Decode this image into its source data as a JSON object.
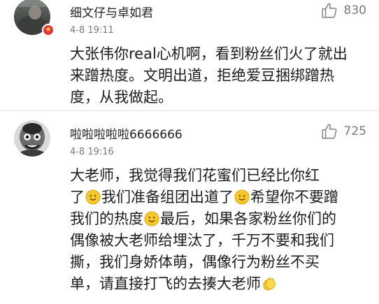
{
  "comments": [
    {
      "username": "细文仔与卓如君",
      "time": "4-8 19:11",
      "likes": "830",
      "body_lines": [
        "大张伟你real心机啊，看到粉丝们火了就出",
        "来蹭热度。文明出道，拒绝爱豆捆绑蹭热",
        "度，从我做起。"
      ]
    },
    {
      "username": "啦啦啦啦啦6666666",
      "time": "4-8 19:16",
      "likes": "725",
      "body": {
        "l1": "大老师，我觉得我们花蜜们已经比你红",
        "l2a": "了",
        "l2b": "我们准备组团出道了",
        "l2c": "希望你不要蹭",
        "l3a": "我们的热度",
        "l3b": "最后，如果各家粉丝你们的",
        "l4": "偶像被大老师给埋汰了，千万不要和我们",
        "l5": "撕，我们身娇体萌，偶像行为粉丝不买",
        "l6a": "单，请直接打飞的去揍大老师"
      }
    }
  ],
  "icons": {
    "like": "thumbs-up-icon",
    "smile": "smile-emoji-icon",
    "clap": "clapping-hands-emoji-icon",
    "badge": "star-badge-icon"
  },
  "colors": {
    "text": "#1c1c1c",
    "meta": "#7a7a7a",
    "badge": "#e0393e",
    "emoji": "#f7c928"
  }
}
